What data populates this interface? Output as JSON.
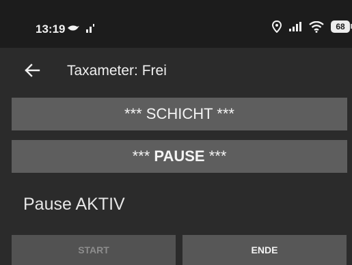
{
  "status_bar": {
    "time": "13:19",
    "left_icons": [
      "notification-bird-icon",
      "network-signal-small-icon"
    ],
    "right_icons": [
      "location-icon",
      "cell-signal-icon",
      "wifi-icon"
    ],
    "battery": "68"
  },
  "app_bar": {
    "title": "Taxameter: Frei"
  },
  "buttons": {
    "schicht_label": "*** SCHICHT ***",
    "pause_prefix": "***",
    "pause_word": "PAUSE",
    "pause_suffix": "***",
    "start_label": "START",
    "ende_label": "ENDE"
  },
  "status": {
    "pause_text": "Pause AKTIV"
  },
  "colors": {
    "status_bar_bg": "#1c1c1c",
    "background": "#2b2b2b",
    "button_bg": "#5e5e5e",
    "disabled_text": "#8d8d8d"
  }
}
